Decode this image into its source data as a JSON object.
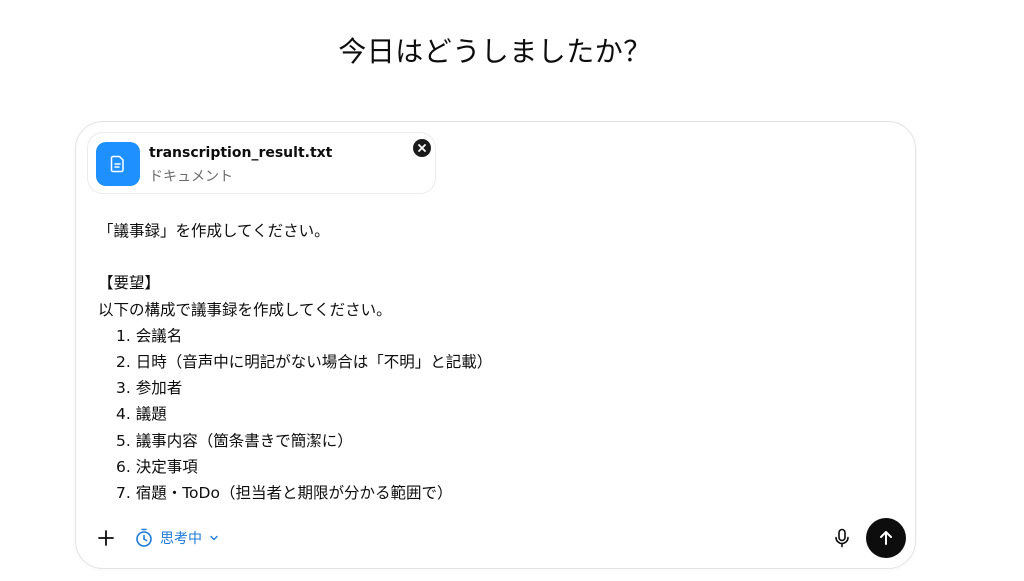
{
  "greeting": "今日はどうしましたか？",
  "attachment": {
    "name": "transcription_result.txt",
    "type": "ドキュメント",
    "icon": "document-icon",
    "icon_color": "#1e90ff"
  },
  "prompt": {
    "lines": [
      "「議事録」を作成してください。",
      "",
      "【要望】",
      "以下の構成で議事録を作成してください。",
      "1. 会議名",
      "2. 日時（音声中に明記がない場合は「不明」と記載）",
      "3. 参加者",
      "4. 議題",
      "5. 議事内容（箇条書きで簡潔に）",
      "6. 決定事項",
      "7. 宿題・ToDo（担当者と期限が分かる範囲で）"
    ]
  },
  "toolbar": {
    "think_label": "思考中",
    "think_color": "#1d7bd8",
    "add_icon": "plus-icon",
    "mic_icon": "microphone-icon",
    "send_icon": "arrow-up-icon"
  }
}
